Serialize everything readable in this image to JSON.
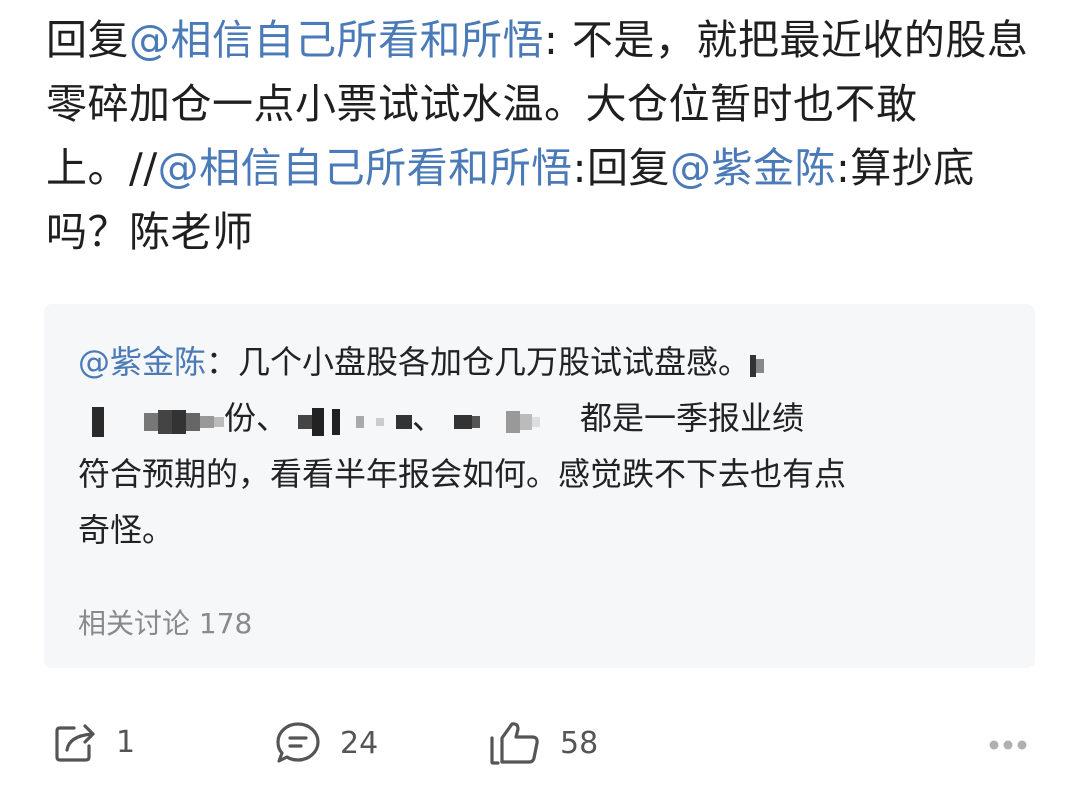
{
  "post": {
    "text_prefix": "回复",
    "mention_1": "@相信自己所看和所悟",
    "text_1": ": 不是，就把最近收的股息零碎加仓一点小票试试水温。大仓位暂时也不敢上。//",
    "mention_2": "@相信自己所看和所悟",
    "text_2": ":回复",
    "mention_3": "@紫金陈",
    "text_3": ":算抄底吗？陈老师"
  },
  "quote": {
    "mention": "@紫金陈",
    "colon": "：",
    "line1_text": "几个小盘股各加仓几万股试试盘感。",
    "line2_part1": "份、",
    "line2_part2": "、",
    "line2_part3": "都是一季报业绩",
    "line3": "符合预期的，看看半年报会如何。感觉跌不下去也有点",
    "line4": "奇怪。",
    "related_label": "相关讨论",
    "related_count": "178"
  },
  "actions": {
    "share_count": "1",
    "comment_count": "24",
    "like_count": "58"
  },
  "colors": {
    "mention": "#4a7ab8",
    "text": "#1f1f1f",
    "card_bg": "#f6f7f9",
    "icon": "#555555"
  },
  "icons": {
    "share": "share-icon",
    "comment": "comment-icon",
    "like": "thumbs-up-icon",
    "more": "more-dots-icon"
  }
}
